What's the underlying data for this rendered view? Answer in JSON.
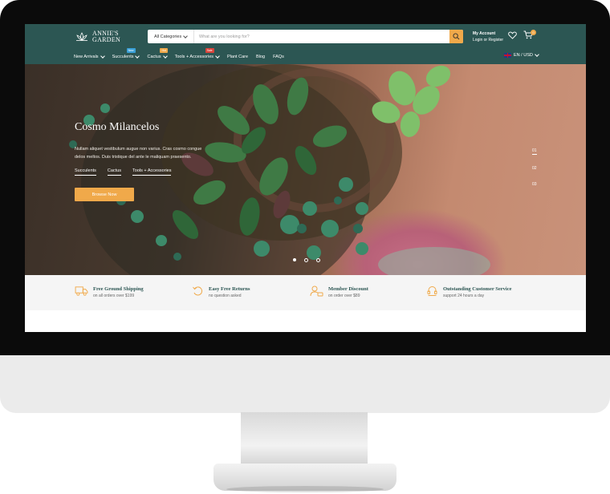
{
  "brand": {
    "line1": "ANNIE'S",
    "line2": "GARDEN"
  },
  "search": {
    "category": "All Categories",
    "placeholder": "What are you looking for?"
  },
  "account": {
    "title": "My Account",
    "links": "Login or Register"
  },
  "cart": {
    "count": "0"
  },
  "nav": {
    "items": [
      {
        "label": "New Arrivals",
        "dropdown": true
      },
      {
        "label": "Succulents",
        "dropdown": true,
        "tag": "New",
        "tag_color": "#3aa0d8"
      },
      {
        "label": "Cactus",
        "dropdown": true,
        "tag": "Hot",
        "tag_color": "#f0a94a"
      },
      {
        "label": "Tools + Accessories",
        "dropdown": true,
        "tag": "Sale",
        "tag_color": "#d9443b"
      },
      {
        "label": "Plant Care",
        "dropdown": false
      },
      {
        "label": "Blog",
        "dropdown": false
      },
      {
        "label": "FAQs",
        "dropdown": false
      }
    ],
    "lang": "EN / USD"
  },
  "hero": {
    "title": "Cosmo Milancelos",
    "desc": "Nullam aliquet vestibulum augue non varius. Cras cosmo congue delos meltos. Duis tristique del ante le maliquam praesento.",
    "links": [
      "Succulents",
      "Cactus",
      "Tools + Accessories"
    ],
    "button": "Browse Now",
    "slides": [
      "01",
      "02",
      "03"
    ],
    "active_slide": 1
  },
  "features": [
    {
      "icon": "truck-icon",
      "title": "Free Ground Shipping",
      "sub": "on all orders over $199"
    },
    {
      "icon": "return-icon",
      "title": "Easy Free Returns",
      "sub": "no question asked"
    },
    {
      "icon": "member-icon",
      "title": "Member Discount",
      "sub": "on order over $89"
    },
    {
      "icon": "support-icon",
      "title": "Outstanding Customer Service",
      "sub": "support 24 hours a day"
    }
  ],
  "colors": {
    "primary": "#2c5653",
    "accent": "#f0a94a"
  }
}
